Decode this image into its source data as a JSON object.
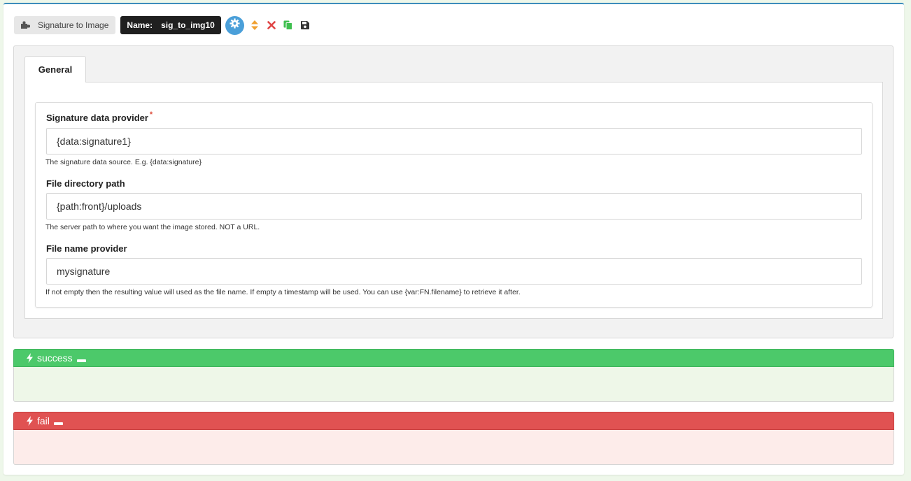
{
  "toolbar": {
    "type_label": "Signature to Image",
    "name_label": "Name:",
    "name_value": "sig_to_img10",
    "icons": [
      "puzzle-icon",
      "gear-icon",
      "sort-icon",
      "close-icon",
      "copy-icon",
      "save-icon"
    ]
  },
  "tabs": [
    {
      "label": "General"
    }
  ],
  "fields": [
    {
      "label": "Signature data provider",
      "required_mark": "*",
      "value": "{data:signature1}",
      "help": "The signature data source. E.g. {data:signature}"
    },
    {
      "label": "File directory path",
      "value": "{path:front}/uploads",
      "help": "The server path to where you want the image stored. NOT a URL."
    },
    {
      "label": "File name provider",
      "value": "mysignature",
      "help": "If not empty then the resulting value will used as the file name. If empty a timestamp will be used. You can use {var:FN.filename} to retrieve it after."
    }
  ],
  "events": {
    "success": {
      "label": "success",
      "color": "#4cc96a"
    },
    "fail": {
      "label": "fail",
      "color": "#e05252"
    }
  },
  "colors": {
    "accent": "#3c8dbc",
    "gear_button": "#4a9fd9",
    "sort": "#f0a030",
    "close": "#e04545",
    "copy": "#3fbf4f",
    "save": "#333333"
  }
}
